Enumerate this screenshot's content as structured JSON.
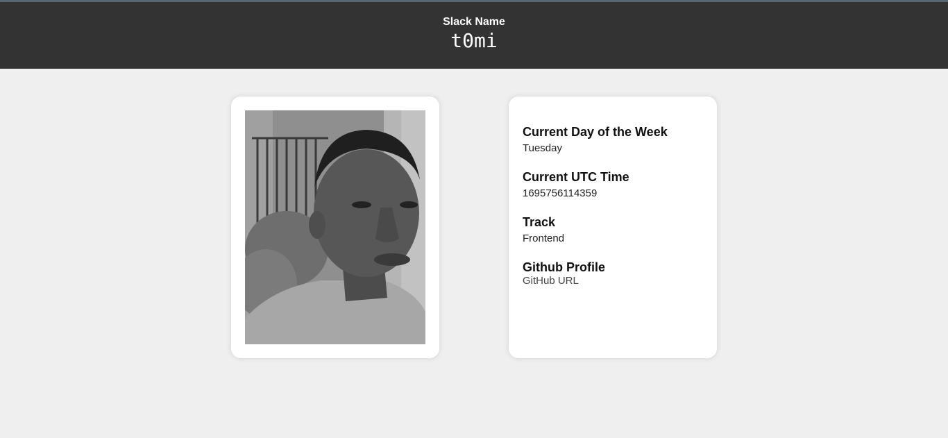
{
  "header": {
    "label": "Slack Name",
    "slack_name": "t0mi"
  },
  "profile": {
    "photo_alt": "Slack profile photo"
  },
  "info": {
    "day_heading": "Current Day of the Week",
    "day_value": "Tuesday",
    "utc_heading": "Current UTC Time",
    "utc_value": "1695756114359",
    "track_heading": "Track",
    "track_value": "Frontend",
    "github_heading": "Github Profile",
    "github_link": "GitHub URL"
  },
  "colors": {
    "header_bg": "#333333",
    "page_bg": "#efefef",
    "card_bg": "#ffffff"
  }
}
